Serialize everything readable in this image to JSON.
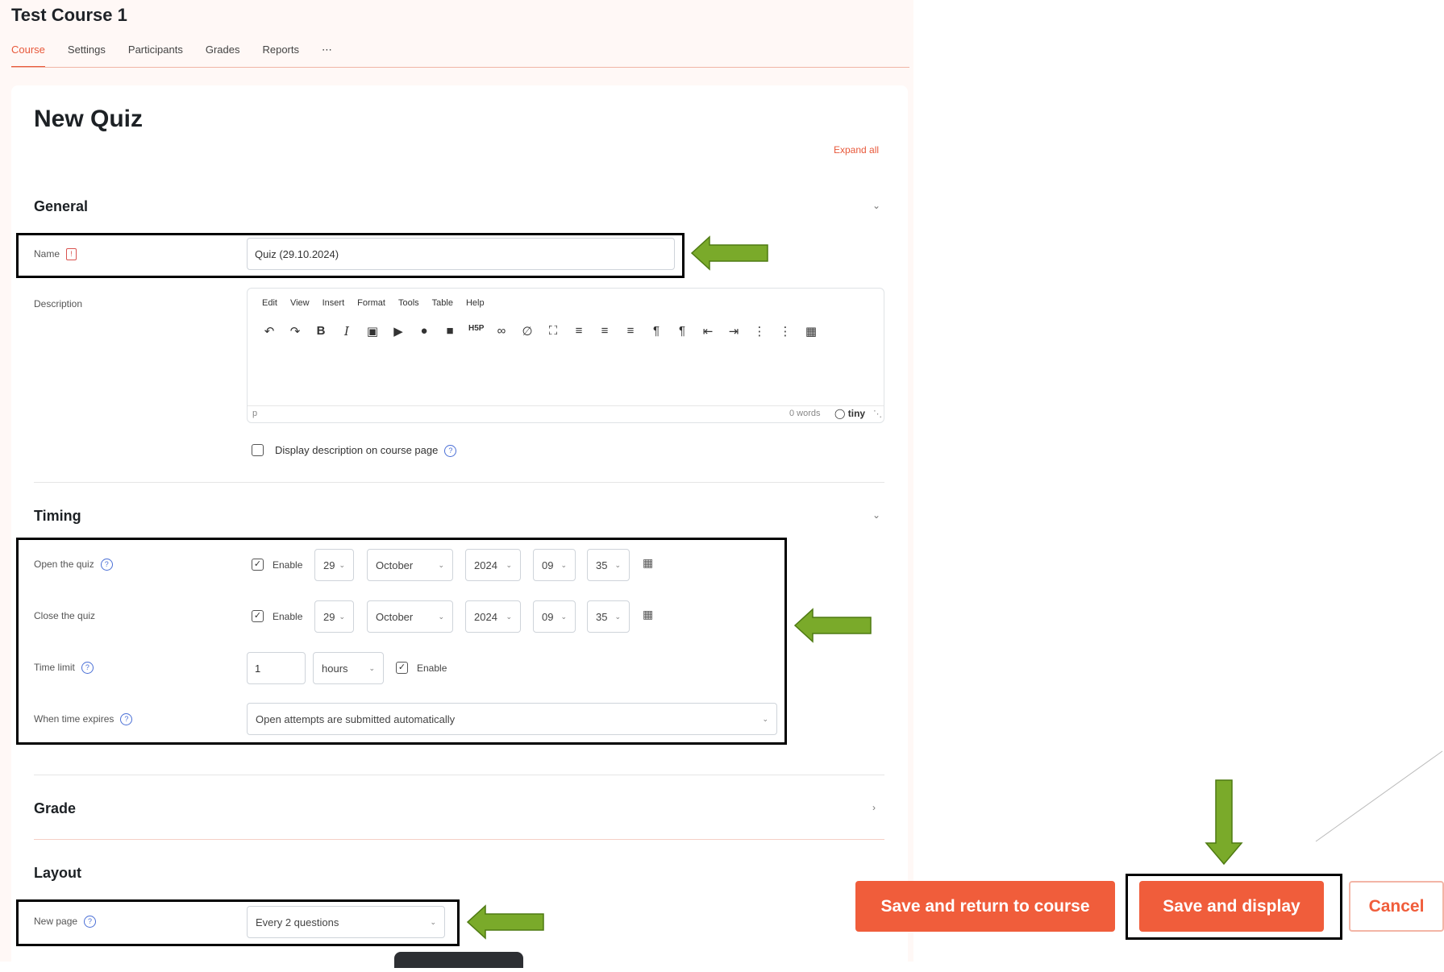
{
  "course": {
    "title": "Test Course 1",
    "nav": [
      "Course",
      "Settings",
      "Participants",
      "Grades",
      "Reports",
      "⋯"
    ]
  },
  "form": {
    "title": "New Quiz",
    "expand_all": "Expand all",
    "general": {
      "heading": "General",
      "name_label": "Name",
      "name_value": "Quiz (29.10.2024)",
      "description_label": "Description",
      "editor_menu": [
        "Edit",
        "View",
        "Insert",
        "Format",
        "Tools",
        "Table",
        "Help"
      ],
      "editor_status_left": "p",
      "editor_word_count": "0 words",
      "editor_brand": "tiny",
      "display_desc_label": "Display description on course page"
    },
    "timing": {
      "heading": "Timing",
      "open_label": "Open the quiz",
      "close_label": "Close the quiz",
      "enable_label": "Enable",
      "open": {
        "day": "29",
        "month": "October",
        "year": "2024",
        "hour": "09",
        "minute": "35"
      },
      "close": {
        "day": "29",
        "month": "October",
        "year": "2024",
        "hour": "09",
        "minute": "35"
      },
      "time_limit_label": "Time limit",
      "time_limit_value": "1",
      "time_limit_unit": "hours",
      "when_expires_label": "When time expires",
      "when_expires_value": "Open attempts are submitted automatically"
    },
    "grade": {
      "heading": "Grade"
    },
    "layout": {
      "heading": "Layout",
      "new_page_label": "New page",
      "new_page_value": "Every 2 questions"
    }
  },
  "buttons": {
    "save_return": "Save and return to course",
    "save_display": "Save and display",
    "cancel": "Cancel"
  },
  "colors": {
    "accent": "#f05d3b",
    "arrow_fill": "#7aaa2a",
    "highlight_border": "#000000"
  }
}
